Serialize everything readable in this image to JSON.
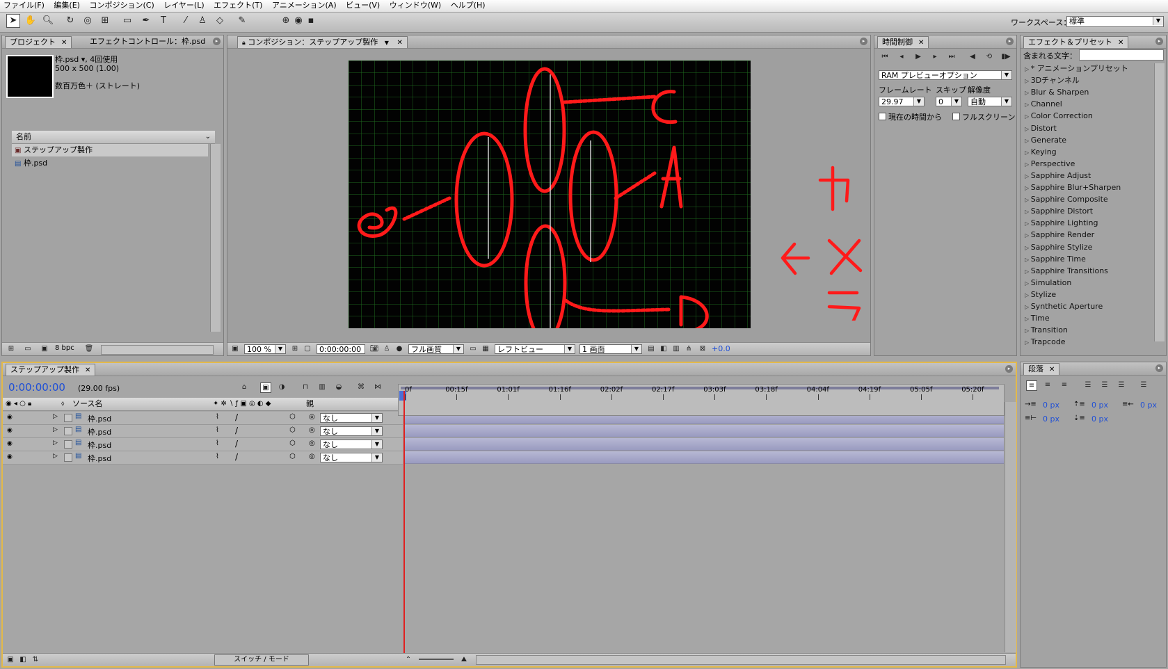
{
  "menu": [
    "ファイル(F)",
    "編集(E)",
    "コンポジション(C)",
    "レイヤー(L)",
    "エフェクト(T)",
    "アニメーション(A)",
    "ビュー(V)",
    "ウィンドウ(W)",
    "ヘルプ(H)"
  ],
  "workspace": {
    "label": "ワークスペース：",
    "value": "標準"
  },
  "project_panel": {
    "tabs": [
      "プロジェクト",
      "エフェクトコントロール：枠.psd"
    ],
    "info_name": "枠.psd ▾, 4回使用",
    "info_size": "500 x 500 (1.00)",
    "info_color": "数百万色＋ (ストレート)",
    "column_name": "名前",
    "items": [
      "ステップアップ製作",
      "枠.psd"
    ],
    "bpc": "8 bpc"
  },
  "comp_panel": {
    "tab": "コンポジション：ステップアップ製作",
    "zoom": "100 %",
    "timecode": "0:00:00:00",
    "quality": "フル画質",
    "view": "レフトビュー",
    "layout": "1 画面",
    "exposure": "+0.0"
  },
  "time_control": {
    "tab": "時間制御",
    "ram_preview": "RAM プレビューオプション",
    "framerate_label": "フレームレート",
    "skip_label": "スキップ",
    "resolution_label": "解像度",
    "framerate": "29.97",
    "skip": "0",
    "resolution": "自動",
    "from_current": "現在の時間から",
    "fullscreen": "フルスクリーン"
  },
  "effects_panel": {
    "tab": "エフェクト＆プリセット",
    "search_label": "含まれる文字：",
    "items": [
      "* アニメーションプリセット",
      "3Dチャンネル",
      "Blur & Sharpen",
      "Channel",
      "Color Correction",
      "Distort",
      "Generate",
      "Keying",
      "Perspective",
      "Sapphire Adjust",
      "Sapphire Blur+Sharpen",
      "Sapphire Composite",
      "Sapphire Distort",
      "Sapphire Lighting",
      "Sapphire Render",
      "Sapphire Stylize",
      "Sapphire Time",
      "Sapphire Transitions",
      "Simulation",
      "Stylize",
      "Synthetic Aperture",
      "Time",
      "Transition",
      "Trapcode"
    ]
  },
  "timeline": {
    "tab": "ステップアップ製作",
    "timecode": "0:00:00:00",
    "fps": "(29.00 fps)",
    "col_source": "ソース名",
    "col_parent": "親",
    "layers": [
      {
        "name": "枠.psd",
        "parent": "なし"
      },
      {
        "name": "枠.psd",
        "parent": "なし"
      },
      {
        "name": "枠.psd",
        "parent": "なし"
      },
      {
        "name": "枠.psd",
        "parent": "なし"
      }
    ],
    "ruler": [
      "0f",
      "00:15f",
      "01:01f",
      "01:16f",
      "02:02f",
      "02:17f",
      "03:03f",
      "03:18f",
      "04:04f",
      "04:19f",
      "05:05f",
      "05:20f"
    ],
    "switch_mode": "スイッチ / モード"
  },
  "paragraph_panel": {
    "tab": "段落",
    "indent_left": "0 px",
    "space_before": "0 px",
    "indent_right": "0 px",
    "indent_first": "0 px",
    "space_after": "0 px"
  },
  "colors": {
    "accent_timecode": "#1f4fd6",
    "playhead": "#e02020",
    "annotation_red": "#ff1a1a"
  }
}
